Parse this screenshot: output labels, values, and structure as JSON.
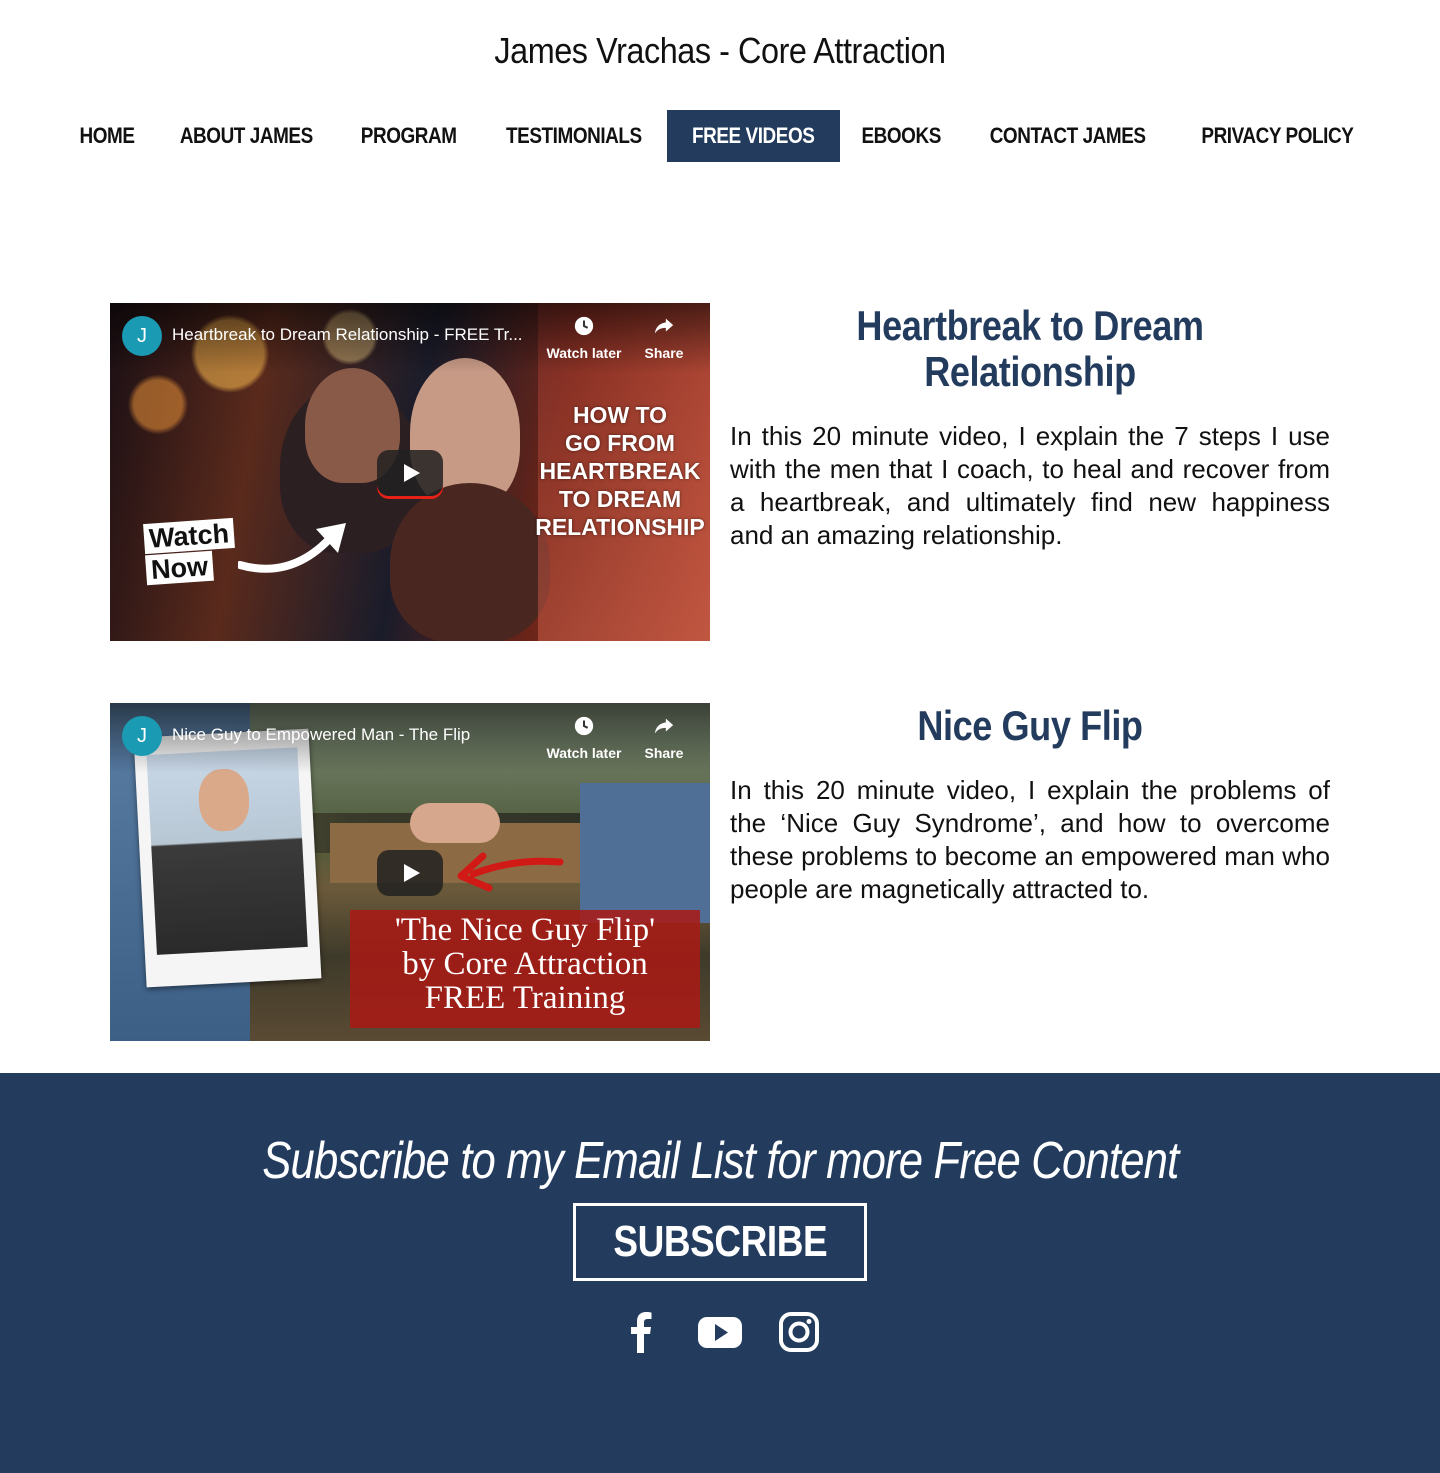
{
  "site": {
    "title": "James Vrachas - Core Attraction"
  },
  "nav": {
    "items": [
      {
        "label": "HOME",
        "active": false
      },
      {
        "label": "ABOUT JAMES",
        "active": false
      },
      {
        "label": "PROGRAM",
        "active": false
      },
      {
        "label": "TESTIMONIALS",
        "active": false
      },
      {
        "label": "FREE VIDEOS",
        "active": true
      },
      {
        "label": "EBOOKS",
        "active": false
      },
      {
        "label": "CONTACT JAMES",
        "active": false
      },
      {
        "label": "PRIVACY POLICY",
        "active": false
      }
    ]
  },
  "videos": [
    {
      "player": {
        "channel_initial": "J",
        "title": "Heartbreak to Dream Relationship - FREE Tr...",
        "watch_later": "Watch later",
        "share": "Share",
        "thumb_text": [
          "HOW TO",
          "GO FROM",
          "HEARTBREAK",
          "TO DREAM",
          "RELATIONSHIP"
        ],
        "watch_badge_1": "Watch",
        "watch_badge_2": "Now"
      },
      "heading": "Heartbreak to Dream Relationship",
      "description": "In this 20 minute video, I explain the 7 steps I use with the men that I coach, to heal and recover from a heartbreak, and ultimately find new happiness and an amazing relationship."
    },
    {
      "player": {
        "channel_initial": "J",
        "title": "Nice Guy to Empowered Man - The Flip",
        "watch_later": "Watch later",
        "share": "Share",
        "thumb_text": [
          "'The Nice Guy Flip'",
          "by Core Attraction",
          "FREE Training"
        ]
      },
      "heading": "Nice Guy Flip",
      "description": "In this 20 minute video, I explain the problems of the ‘Nice Guy Syndrome’, and how to overcome these problems to become an empowered man who people are magnetically attracted to."
    }
  ],
  "footer": {
    "heading": "Subscribe to my Email List for more Free Content",
    "subscribe_label": "SUBSCRIBE",
    "social": [
      "facebook-icon",
      "youtube-icon",
      "instagram-icon"
    ],
    "colors": {
      "background": "#233c5e",
      "accent": "#233c5e"
    }
  }
}
